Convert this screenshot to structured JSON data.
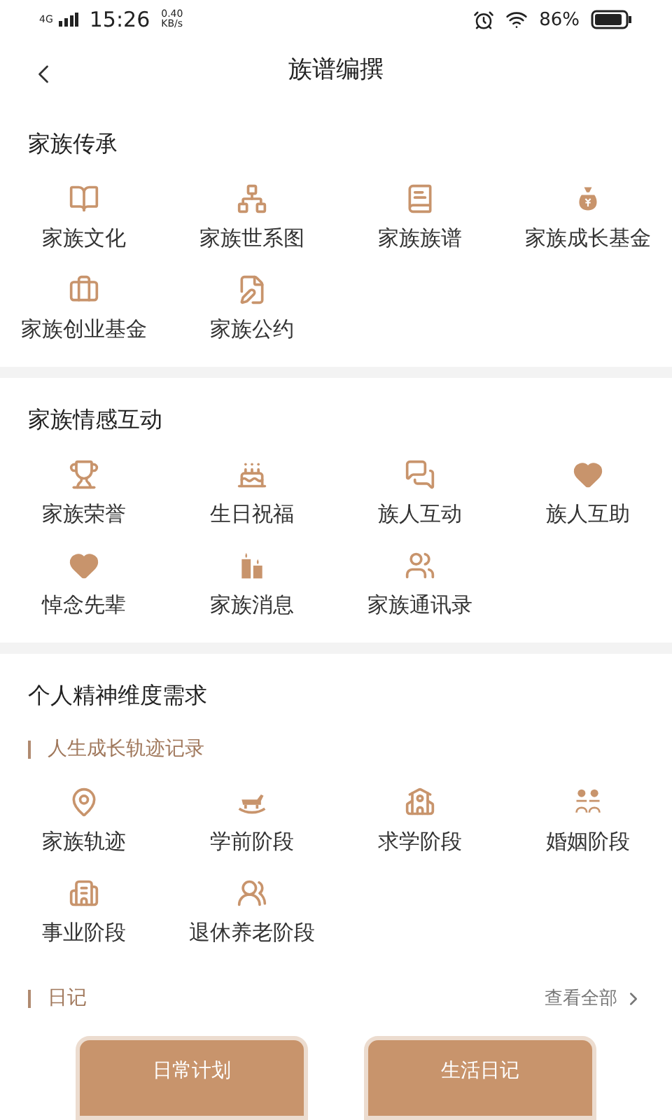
{
  "status_bar": {
    "network": "4G",
    "time": "15:26",
    "speed_value": "0.40",
    "speed_unit": "KB/s",
    "battery": "86%"
  },
  "header": {
    "title": "族谱编撰"
  },
  "sections": [
    {
      "title": "家族传承",
      "items": [
        {
          "label": "家族文化"
        },
        {
          "label": "家族世系图"
        },
        {
          "label": "家族族谱"
        },
        {
          "label": "家族成长基金"
        },
        {
          "label": "家族创业基金"
        },
        {
          "label": "家族公约"
        }
      ]
    },
    {
      "title": "家族情感互动",
      "items": [
        {
          "label": "家族荣誉"
        },
        {
          "label": "生日祝福"
        },
        {
          "label": "族人互动"
        },
        {
          "label": "族人互助"
        },
        {
          "label": "悼念先辈"
        },
        {
          "label": "家族消息"
        },
        {
          "label": "家族通讯录"
        }
      ]
    },
    {
      "title": "个人精神维度需求",
      "subtitle": "人生成长轨迹记录",
      "items": [
        {
          "label": "家族轨迹"
        },
        {
          "label": "学前阶段"
        },
        {
          "label": "求学阶段"
        },
        {
          "label": "婚姻阶段"
        },
        {
          "label": "事业阶段"
        },
        {
          "label": "退休养老阶段"
        }
      ]
    }
  ],
  "diary": {
    "title": "日记",
    "link": "查看全部",
    "cards": [
      {
        "label": "日常计划"
      },
      {
        "label": "生活日记"
      }
    ]
  }
}
